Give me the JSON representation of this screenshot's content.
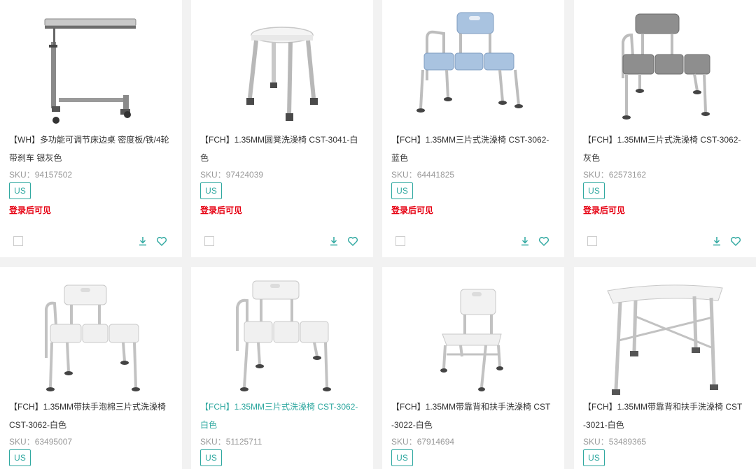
{
  "currency_badge_label": "US",
  "login_prompt": "登录后可见",
  "sku_prefix": "SKU：",
  "products": [
    {
      "title_lines": [
        "【WH】多功能可调节床边桌 密度板/铁/4轮",
        "带刹车 银灰色"
      ],
      "sku": "94157502",
      "image": "overbed-table"
    },
    {
      "title_lines": [
        "【FCH】1.35MM圆凳洗澡椅 CST-3041-白",
        "色"
      ],
      "sku": "97424039",
      "image": "round-shower-stool"
    },
    {
      "title_lines": [
        "【FCH】1.35MM三片式洗澡椅 CST-3062-",
        "蓝色"
      ],
      "sku": "64441825",
      "image": "transfer-bench-blue"
    },
    {
      "title_lines": [
        "【FCH】1.35MM三片式洗澡椅 CST-3062-",
        "灰色"
      ],
      "sku": "62573162",
      "image": "transfer-bench-grey"
    },
    {
      "title_lines": [
        "【FCH】1.35MM带扶手泡棉三片式洗澡椅",
        "CST-3062-白色"
      ],
      "sku": "63495007",
      "image": "transfer-bench-white-padded"
    },
    {
      "title_lines": [
        "【FCH】1.35MM三片式洗澡椅 CST-3062-",
        "白色"
      ],
      "sku": "51125711",
      "image": "transfer-bench-white",
      "highlighted": true
    },
    {
      "title_lines": [
        "【FCH】1.35MM带靠背和扶手洗澡椅 CST",
        "-3022-白色"
      ],
      "sku": "67914694",
      "image": "shower-chair-backrest"
    },
    {
      "title_lines": [
        "【FCH】1.35MM带靠背和扶手洗澡椅 CST",
        "-3021-白色"
      ],
      "sku": "53489365",
      "image": "wide-shower-bench"
    }
  ],
  "colors": {
    "accent": "#2fa8a0",
    "login_red": "#e60012",
    "page_bg": "#f2f2f2",
    "card_bg": "#ffffff",
    "sku_grey": "#999999"
  }
}
